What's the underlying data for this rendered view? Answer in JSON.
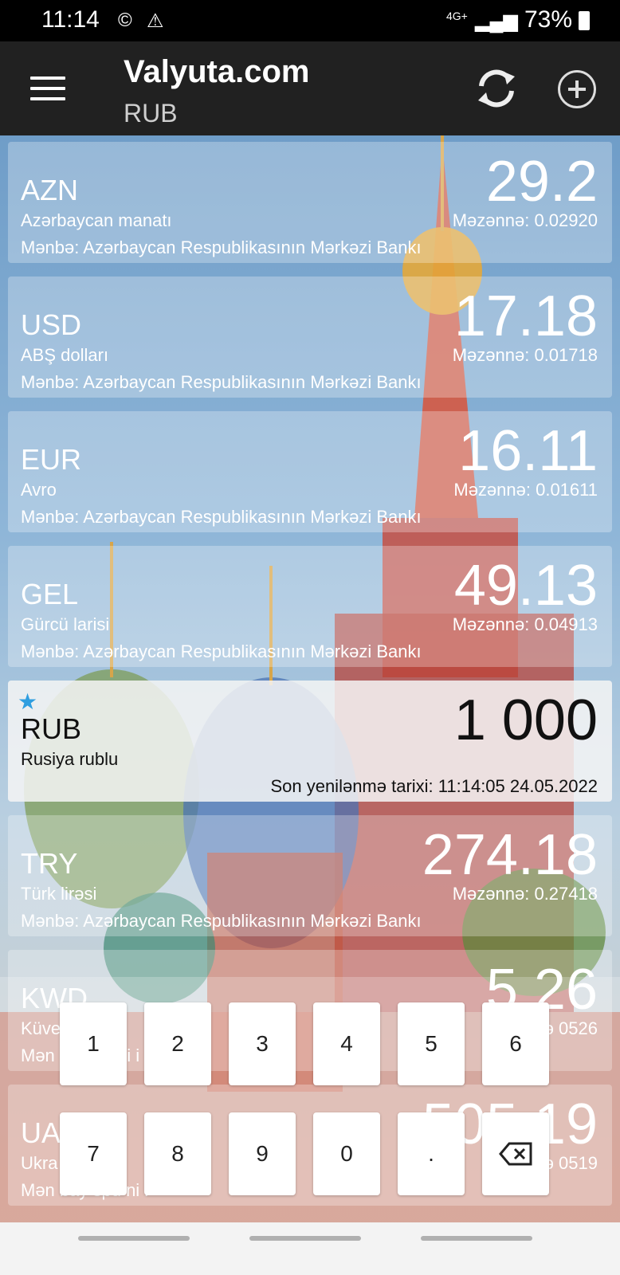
{
  "status_bar": {
    "time": "11:14",
    "network": "4G+",
    "battery": "73%"
  },
  "app_bar": {
    "title": "Valyuta.com",
    "subtitle": "RUB",
    "menu_icon": "hamburger-menu-icon",
    "refresh_icon": "refresh-icon",
    "add_icon": "add-circle-icon"
  },
  "currencies": [
    {
      "code": "AZN",
      "name": "Azərbaycan manatı",
      "amount": "29.2",
      "rate": "Məzənnə: 0.02920",
      "source": "Mənbə: Azərbaycan Respublikasının Mərkəzi Bankı"
    },
    {
      "code": "USD",
      "name": "ABŞ dolları",
      "amount": "17.18",
      "rate": "Məzənnə: 0.01718",
      "source": "Mənbə: Azərbaycan Respublikasının Mərkəzi Bankı"
    },
    {
      "code": "EUR",
      "name": "Avro",
      "amount": "16.11",
      "rate": "Məzənnə: 0.01611",
      "source": "Mənbə: Azərbaycan Respublikasının Mərkəzi Bankı"
    },
    {
      "code": "GEL",
      "name": "Gürcü larisi",
      "amount": "49.13",
      "rate": "Məzənnə: 0.04913",
      "source": "Mənbə: Azərbaycan Respublikasının Mərkəzi Bankı"
    },
    {
      "code": "RUB",
      "name": "Rusiya rublu",
      "amount": "1 000",
      "updated": "Son yenilənmə tarixi: 11:14:05 24.05.2022",
      "favorite_icon": "star-icon"
    },
    {
      "code": "TRY",
      "name": "Türk lirəsi",
      "amount": "274.18",
      "rate": "Məzənnə: 0.27418",
      "source": "Mənbə: Azərbaycan Respublikasının Mərkəzi Bankı"
    },
    {
      "code": "KWD",
      "name": "Küve",
      "amount": "5.26",
      "rate": "ə 0526",
      "source": "Mən ba spu ni i"
    },
    {
      "code": "UA",
      "name": "Ukra na",
      "amount": "505.19",
      "rate": "ə 0519",
      "source": "Mən bay spu ni i"
    }
  ],
  "keypad": {
    "row1": [
      "1",
      "2",
      "3",
      "4",
      "5",
      "6"
    ],
    "row2": [
      "7",
      "8",
      "9",
      "0",
      "."
    ],
    "backspace_icon": "backspace-icon"
  },
  "colors": {
    "app_bar": "#212121",
    "status_bar": "#000000",
    "star": "#2f9ee0"
  }
}
